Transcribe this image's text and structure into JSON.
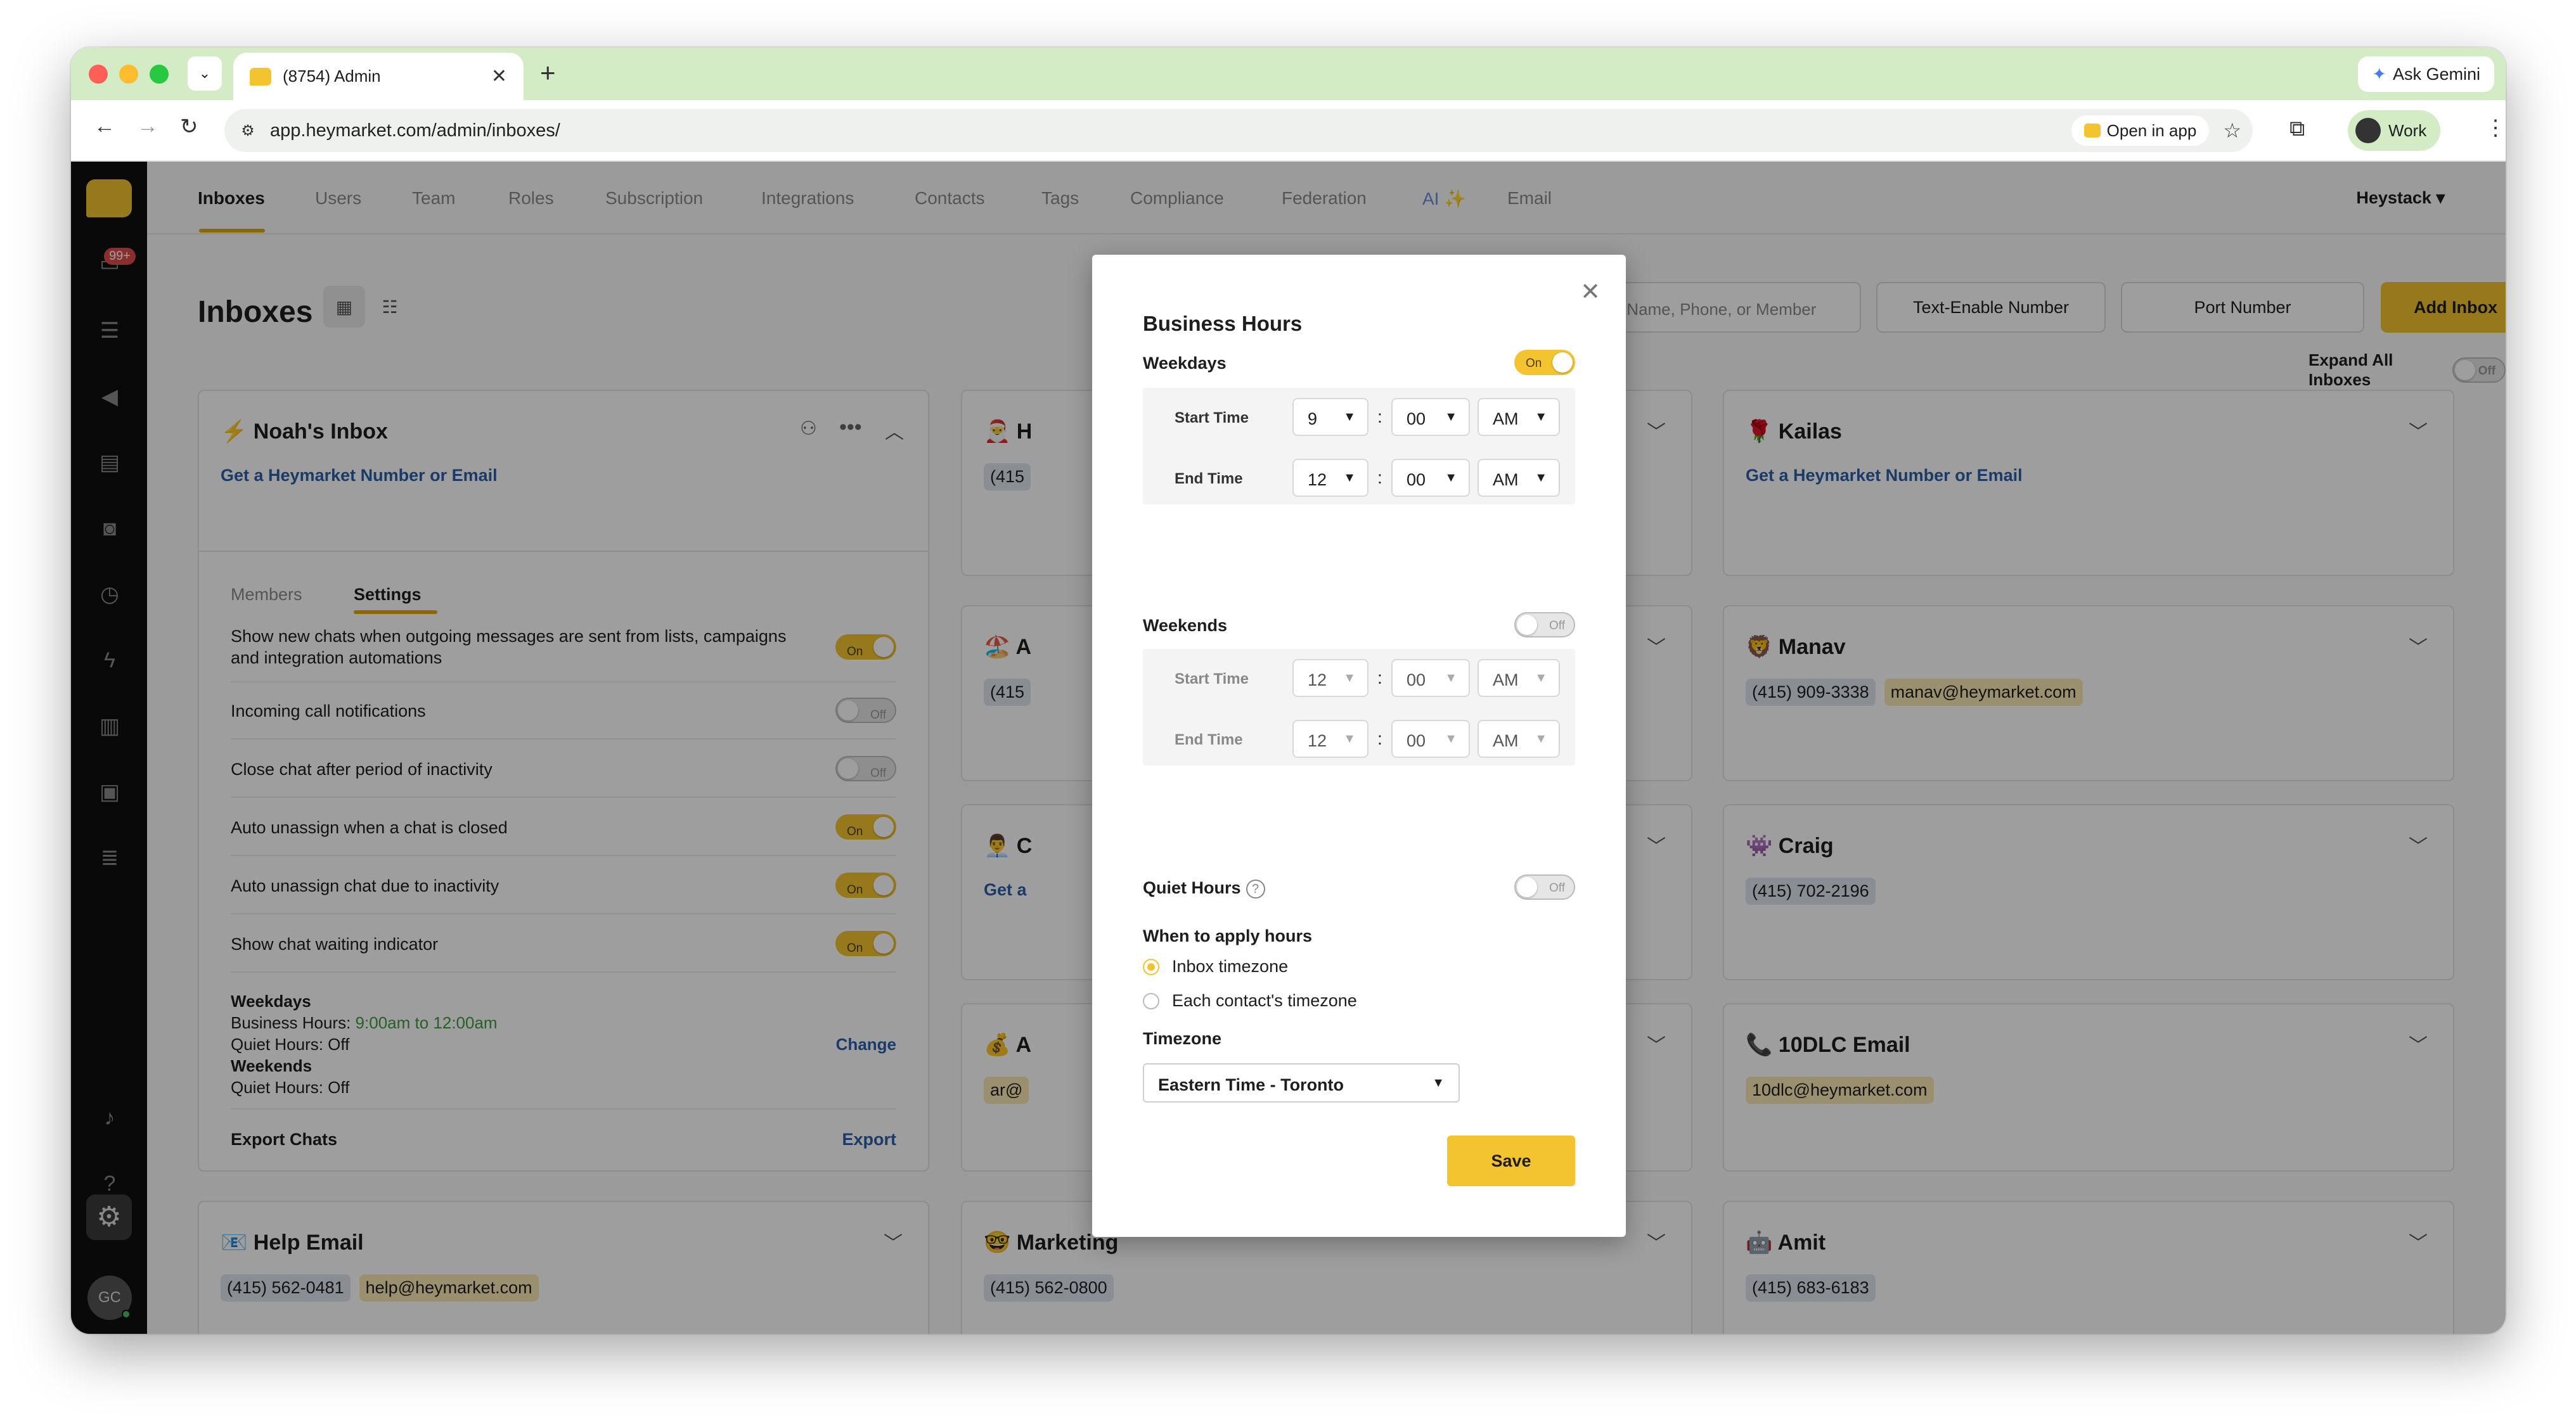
{
  "browser": {
    "tab_title": "(8754) Admin",
    "url": "app.heymarket.com/admin/inboxes/",
    "open_in_app": "Open in app",
    "ask_gemini": "Ask Gemini",
    "profile": "Work"
  },
  "sidebar": {
    "badge": "99+",
    "avatar_initials": "GC"
  },
  "topnav": {
    "items": [
      "Inboxes",
      "Users",
      "Team",
      "Roles",
      "Subscription",
      "Integrations",
      "Contacts",
      "Tags",
      "Compliance",
      "Federation",
      "AI ✨",
      "Email"
    ],
    "active": "Inboxes",
    "org": "Heystack ▾"
  },
  "page": {
    "title": "Inboxes",
    "search_placeholder": "Search by Name, Phone, or Member",
    "text_enable": "Text-Enable Number",
    "port_number": "Port Number",
    "add_inbox": "Add Inbox",
    "expand_all": "Expand All Inboxes",
    "expand_toggle": "Off"
  },
  "noah": {
    "name": "⚡ Noah's Inbox",
    "link": "Get a Heymarket Number or Email",
    "tab_members": "Members",
    "tab_settings": "Settings",
    "settings": [
      {
        "label": "Show new chats when outgoing messages are sent from lists, campaigns and integration automations",
        "state": "On"
      },
      {
        "label": "Incoming call notifications",
        "state": "Off"
      },
      {
        "label": "Close chat after period of inactivity",
        "state": "Off"
      },
      {
        "label": "Auto unassign when a chat is closed",
        "state": "On"
      },
      {
        "label": "Auto unassign chat due to inactivity",
        "state": "On"
      },
      {
        "label": "Show chat waiting indicator",
        "state": "On"
      }
    ],
    "hours": {
      "weekdays": "Weekdays",
      "bh_label": "Business Hours:",
      "bh_value": "9:00am to 12:00am",
      "quiet_weekdays": "Quiet Hours: Off",
      "weekends": "Weekends",
      "quiet_weekends": "Quiet Hours: Off",
      "change": "Change"
    },
    "export_label": "Export Chats",
    "export_link": "Export"
  },
  "cards": {
    "c2": {
      "name": "🎅 H",
      "chips": [
        "(415"
      ]
    },
    "c3": {
      "name": "🏖️ A",
      "chips": [
        "(415"
      ]
    },
    "c4": {
      "name": "👨‍💼 C",
      "link": "Get a"
    },
    "c5": {
      "name": "💰 A",
      "chips": [
        "ar@"
      ]
    },
    "kailas": {
      "name": "🌹 Kailas",
      "link": "Get a Heymarket Number or Email"
    },
    "manav": {
      "name": "🦁 Manav",
      "phone": "(415) 909-3338",
      "email": "manav@heymarket.com"
    },
    "craig": {
      "name": "👾 Craig",
      "phone": "(415) 702-2196"
    },
    "tendlc": {
      "name": "📞 10DLC Email",
      "email": "10dlc@heymarket.com"
    },
    "help": {
      "name": "📧 Help Email",
      "phone": "(415) 562-0481",
      "email": "help@heymarket.com"
    },
    "marketing": {
      "name": "🤓 Marketing",
      "phone": "(415) 562-0800"
    },
    "amit": {
      "name": "🤖 Amit",
      "phone": "(415) 683-6183"
    }
  },
  "modal": {
    "title": "Business Hours",
    "weekdays": "Weekdays",
    "weekdays_toggle": "On",
    "weekdays_start_label": "Start Time",
    "weekdays_start": {
      "hour": "9",
      "minute": "00",
      "ampm": "AM"
    },
    "weekdays_end_label": "End Time",
    "weekdays_end": {
      "hour": "12",
      "minute": "00",
      "ampm": "AM"
    },
    "weekends": "Weekends",
    "weekends_toggle": "Off",
    "weekends_start_label": "Start Time",
    "weekends_start": {
      "hour": "12",
      "minute": "00",
      "ampm": "AM"
    },
    "weekends_end_label": "End Time",
    "weekends_end": {
      "hour": "12",
      "minute": "00",
      "ampm": "AM"
    },
    "quiet_hours": "Quiet Hours",
    "quiet_toggle": "Off",
    "apply_label": "When to apply hours",
    "opt_inbox": "Inbox timezone",
    "opt_contact": "Each contact's timezone",
    "selected_option": "Inbox timezone",
    "timezone_label": "Timezone",
    "timezone_value": "Eastern Time - Toronto",
    "save": "Save"
  },
  "colors": {
    "accent": "#f4c430",
    "tabstrip": "#d3ecc6",
    "link": "#2b5ea8",
    "green_text": "#3f9b3f"
  }
}
